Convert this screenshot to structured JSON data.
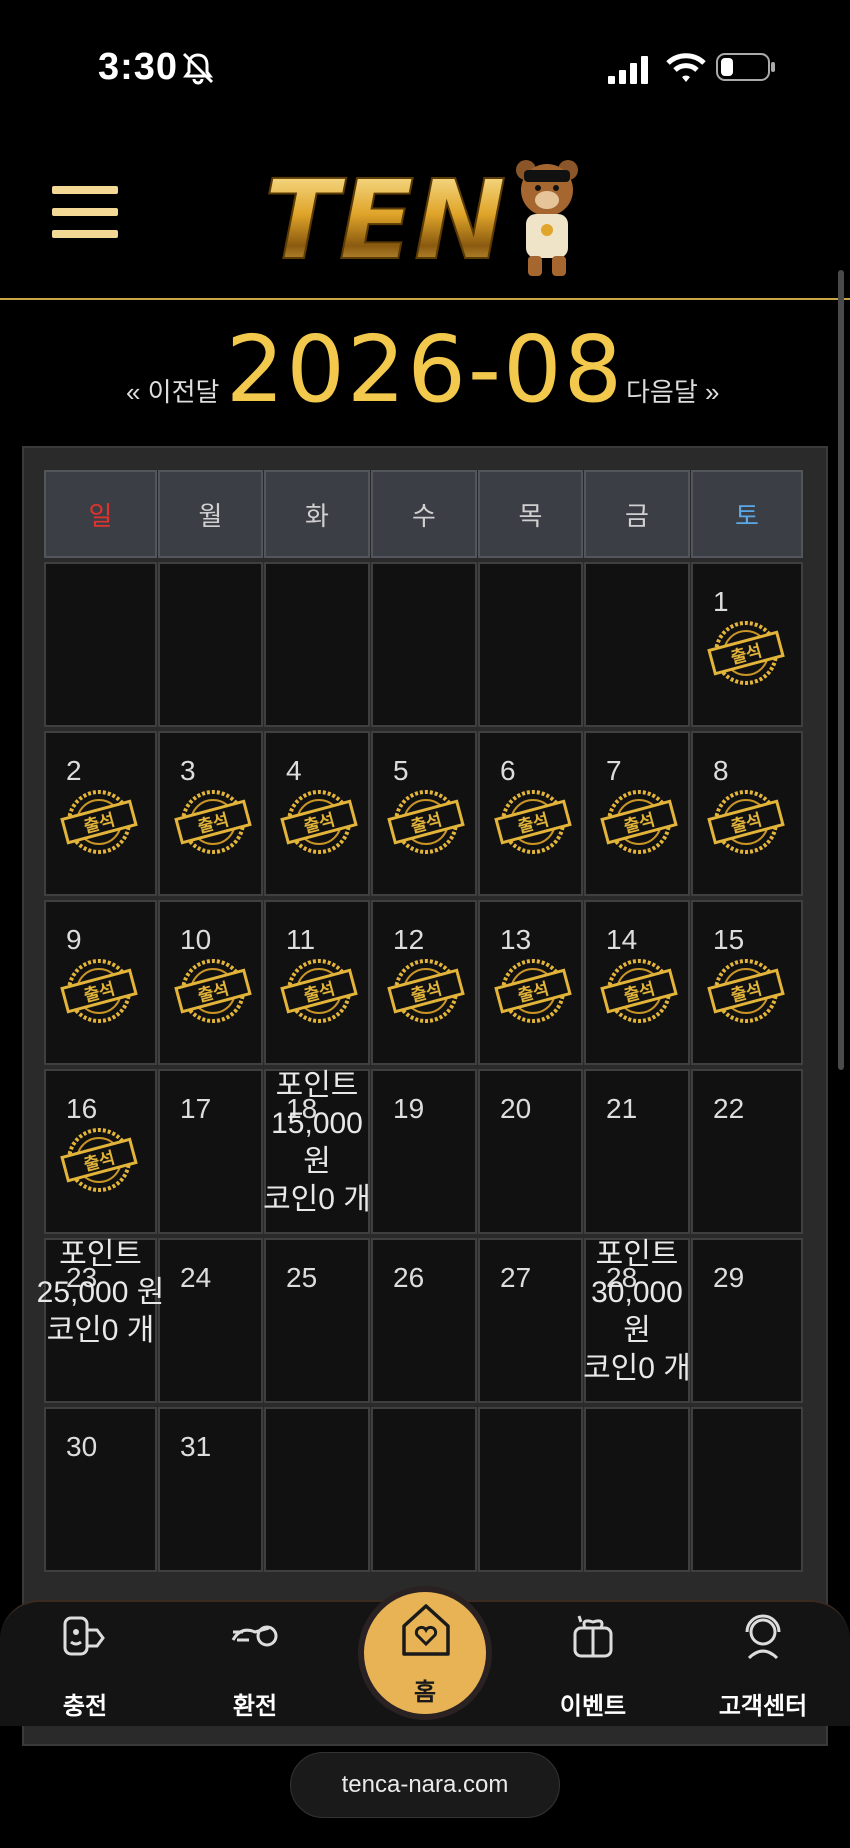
{
  "status_bar": {
    "time": "3:30"
  },
  "header": {
    "logo_text": "TEN"
  },
  "calendar": {
    "prev_label": "« 이전달",
    "month": "2026-08",
    "next_label": "다음달 »",
    "weekdays": [
      "일",
      "월",
      "화",
      "수",
      "목",
      "금",
      "토"
    ],
    "stamp_text": "출석",
    "days": [
      "1",
      "2",
      "3",
      "4",
      "5",
      "6",
      "7",
      "8",
      "9",
      "10",
      "11",
      "12",
      "13",
      "14",
      "15",
      "16",
      "17",
      "18",
      "19",
      "20",
      "21",
      "22",
      "23",
      "24",
      "25",
      "26",
      "27",
      "28",
      "29",
      "30",
      "31"
    ],
    "attended_days": [
      1,
      2,
      3,
      4,
      5,
      6,
      7,
      8,
      9,
      10,
      11,
      12,
      13,
      14,
      15,
      16
    ],
    "bonuses": {
      "18": {
        "points": "포인트 15,000 원",
        "coins": "코인0 개"
      },
      "23": {
        "points": "포인트 25,000 원",
        "coins": "코인0 개"
      },
      "28": {
        "points": "포인트 30,000 원",
        "coins": "코인0 개"
      }
    }
  },
  "bottom_nav": {
    "charge": "충전",
    "exchange": "환전",
    "home": "홈",
    "event": "이벤트",
    "support": "고객센터"
  },
  "browser": {
    "url": "tenca-nara.com"
  },
  "colors": {
    "gold": "#f2c94c",
    "sunday": "#e0332e",
    "saturday": "#5aa9e6",
    "home_button": "#e8b355"
  }
}
